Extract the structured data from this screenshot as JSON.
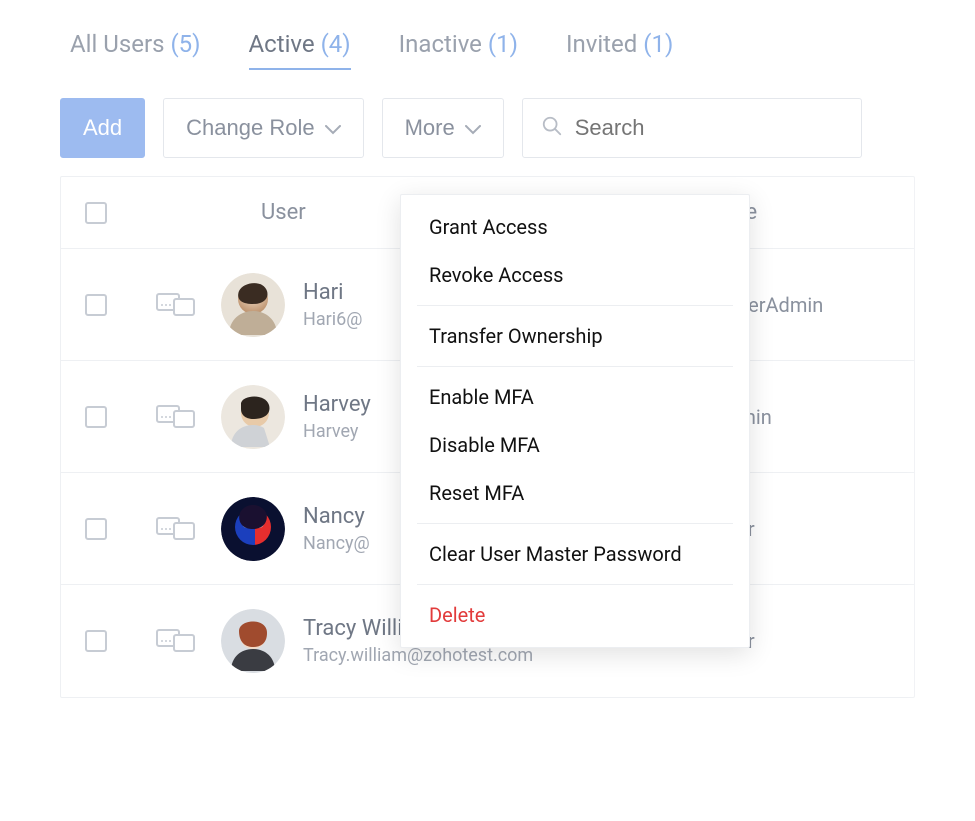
{
  "tabs": [
    {
      "label": "All Users",
      "count": "(5)",
      "active": false
    },
    {
      "label": "Active",
      "count": "(4)",
      "active": true
    },
    {
      "label": "Inactive",
      "count": "(1)",
      "active": false
    },
    {
      "label": "Invited",
      "count": "(1)",
      "active": false
    }
  ],
  "toolbar": {
    "add": "Add",
    "change_role": "Change Role",
    "more": "More",
    "search_placeholder": "Search"
  },
  "columns": {
    "user": "User",
    "role": "Role"
  },
  "rows": [
    {
      "name": "Hari",
      "email": "Hari6@",
      "role": "SuperAdmin",
      "avatar": "a1"
    },
    {
      "name": "Harvey",
      "email": "Harvey",
      "role": "Admin",
      "avatar": "a2"
    },
    {
      "name": "Nancy",
      "email": "Nancy@",
      "role": "User",
      "avatar": "a3"
    },
    {
      "name": "Tracy William",
      "email": "Tracy.william@zohotest.com",
      "role": "User",
      "avatar": "a4"
    }
  ],
  "menu": {
    "grant": "Grant Access",
    "revoke": "Revoke Access",
    "transfer": "Transfer Ownership",
    "enable_mfa": "Enable MFA",
    "disable_mfa": "Disable MFA",
    "reset_mfa": "Reset MFA",
    "clear_pw": "Clear User Master Password",
    "delete": "Delete"
  }
}
